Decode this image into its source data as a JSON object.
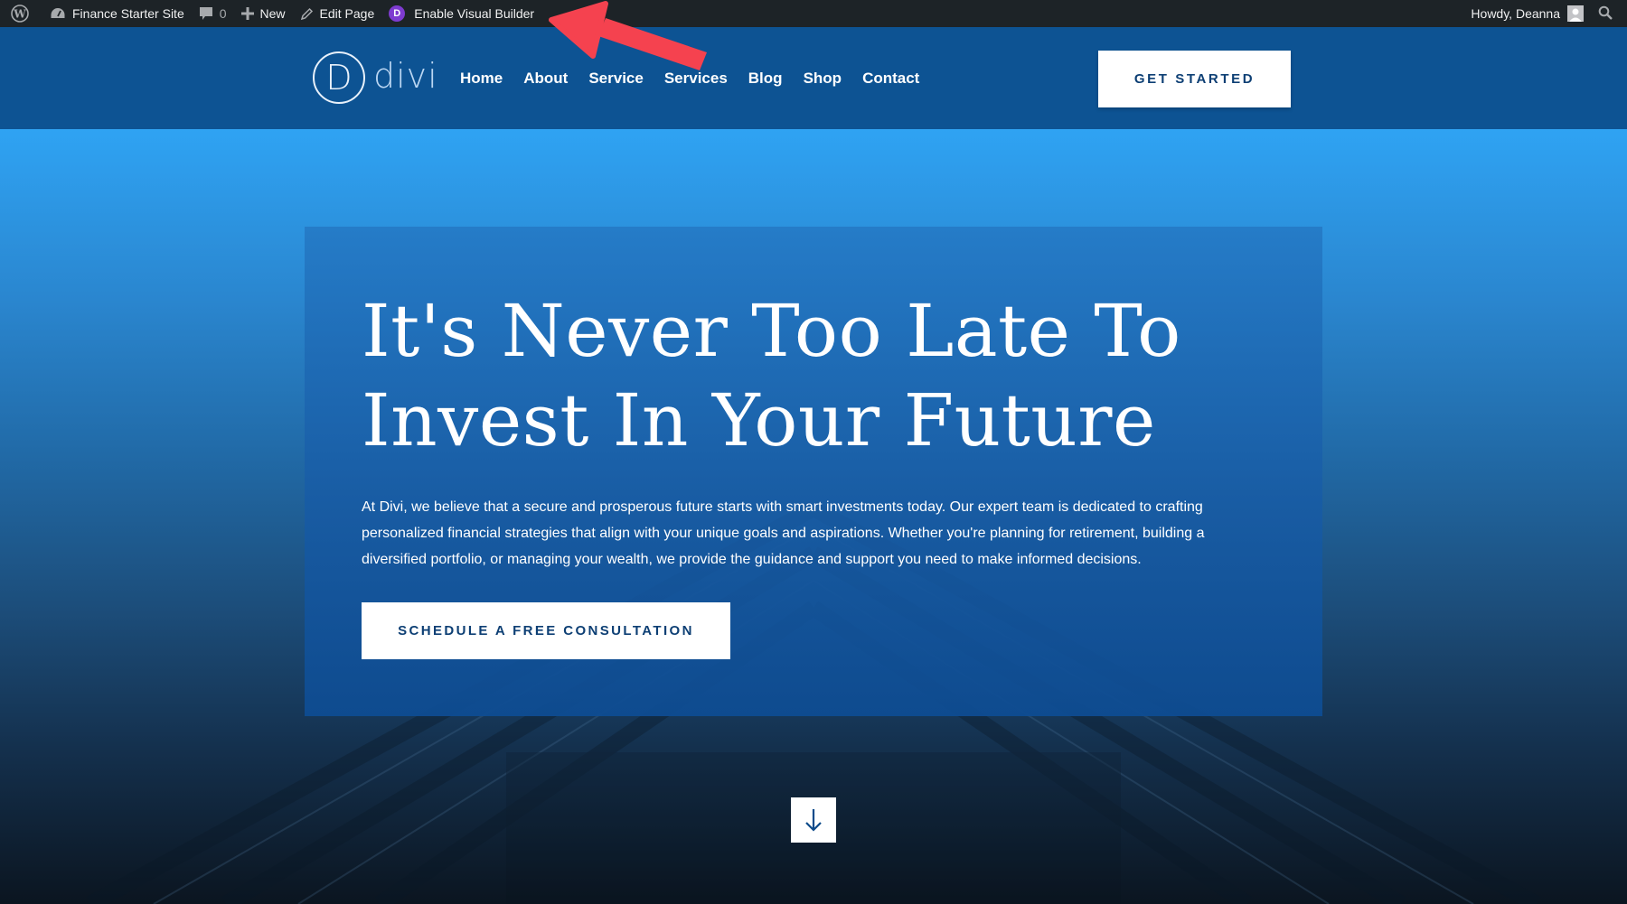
{
  "adminbar": {
    "site_name": "Finance Starter Site",
    "comments_count": "0",
    "new_label": "New",
    "edit_label": "Edit Page",
    "builder_badge": "D",
    "builder_label": "Enable Visual Builder",
    "howdy": "Howdy, Deanna"
  },
  "header": {
    "logo_letter": "D",
    "logo_text": "divi",
    "nav": [
      "Home",
      "About",
      "Service",
      "Services",
      "Blog",
      "Shop",
      "Contact"
    ],
    "cta_label": "GET STARTED"
  },
  "hero": {
    "title_line1": "It's Never Too Late To",
    "title_line2": "Invest In Your Future",
    "body": "At Divi, we believe that a secure and prosperous future starts with smart investments today. Our expert team is dedicated to crafting personalized financial strategies that align with your unique goals and aspirations. Whether you're planning for retirement, building a diversified portfolio, or managing your wealth, we provide the guidance and support you need to make informed decisions.",
    "cta_label": "SCHEDULE A FREE CONSULTATION"
  },
  "colors": {
    "adminbar_bg": "#1d2327",
    "header_bg": "#0d5393",
    "button_text": "#0d3f74",
    "builder_purple": "#7e3bd0",
    "annotation_red": "#f5424f"
  }
}
